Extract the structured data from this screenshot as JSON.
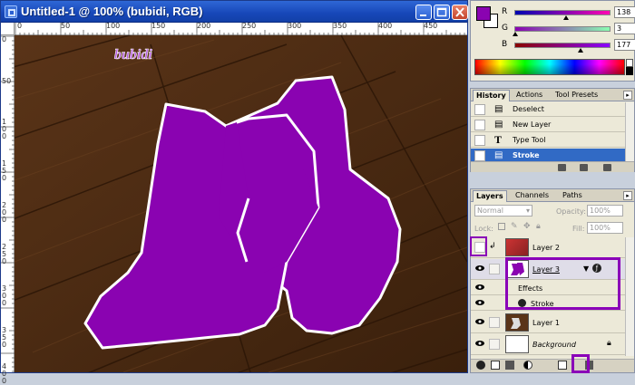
{
  "document": {
    "title": "Untitled-1 @ 100% (bubidi, RGB)",
    "watermark": "bubidi",
    "ruler_top_labels": [
      "0",
      "50",
      "100",
      "150",
      "200",
      "250",
      "300",
      "350",
      "400",
      "450"
    ],
    "ruler_left_labels": [
      "0",
      "50",
      "100",
      "150",
      "200",
      "250",
      "300",
      "350",
      "400"
    ]
  },
  "color_panel": {
    "foreground": "#8a03b1",
    "channels": [
      {
        "label": "R",
        "value": "138",
        "fraction": 0.54
      },
      {
        "label": "G",
        "value": "3",
        "fraction": 0.01
      },
      {
        "label": "B",
        "value": "177",
        "fraction": 0.69
      }
    ]
  },
  "history_panel": {
    "tabs": [
      "History",
      "Actions",
      "Tool Presets"
    ],
    "items": [
      {
        "icon": "document-icon",
        "label": "Deselect"
      },
      {
        "icon": "document-icon",
        "label": "New Layer"
      },
      {
        "icon": "type-icon",
        "label": "Type Tool"
      },
      {
        "icon": "document-icon",
        "label": "Stroke",
        "selected": true
      }
    ]
  },
  "layers_panel": {
    "tabs": [
      "Layers",
      "Channels",
      "Paths"
    ],
    "blend_mode": "Normal",
    "opacity_label": "Opacity:",
    "opacity_value": "100%",
    "lock_label": "Lock:",
    "fill_label": "Fill:",
    "fill_value": "100%",
    "layers": [
      {
        "name": "Layer 2",
        "visible": false
      },
      {
        "name": "Layer 3",
        "visible": true,
        "selected": true,
        "effects_label": "Effects",
        "effect": "Stroke"
      },
      {
        "name": "Layer 1",
        "visible": true
      },
      {
        "name": "Background",
        "visible": true,
        "locked": true
      }
    ]
  }
}
